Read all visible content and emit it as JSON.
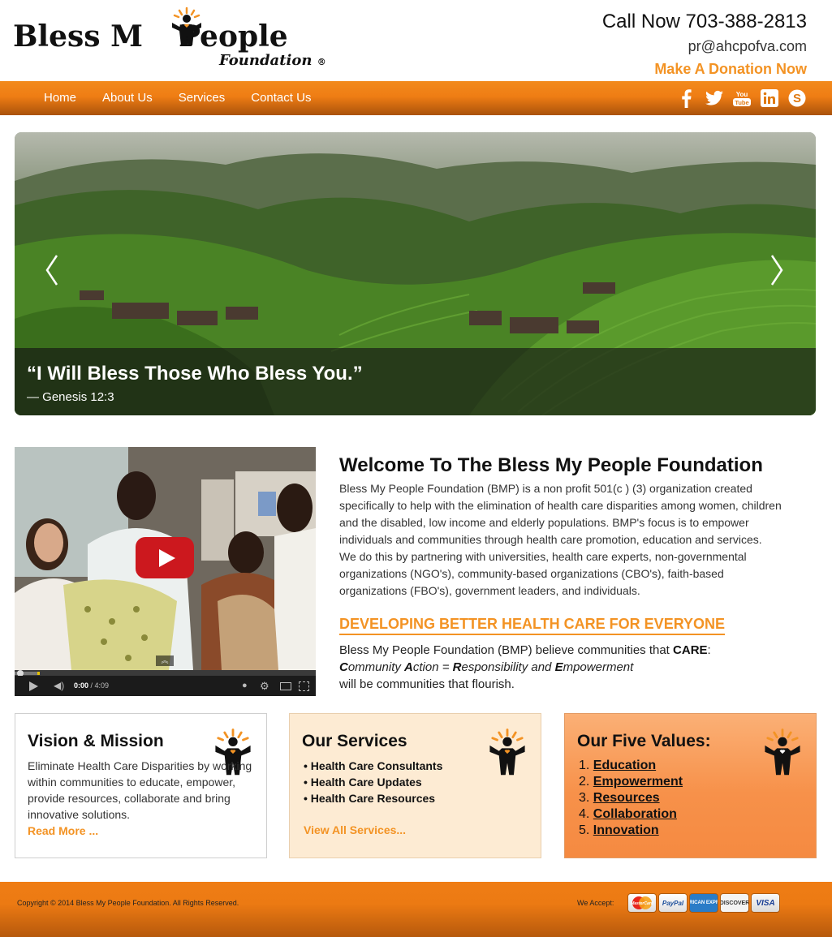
{
  "brand": {
    "name": "Bless My People",
    "name_left": "Bless M",
    "name_right": "People",
    "subtitle": "Foundation",
    "registered": "®"
  },
  "contact": {
    "call": "Call Now 703-388-2813",
    "email": "pr@ahcpofva.com",
    "donate": "Make A Donation Now"
  },
  "nav": {
    "items": [
      {
        "label": "Home"
      },
      {
        "label": "About Us"
      },
      {
        "label": "Services"
      },
      {
        "label": "Contact Us"
      }
    ]
  },
  "social": [
    {
      "icon": "facebook-icon",
      "glyph": "f"
    },
    {
      "icon": "twitter-icon",
      "glyph": "t"
    },
    {
      "icon": "youtube-icon",
      "glyph": "You Tube"
    },
    {
      "icon": "linkedin-icon",
      "glyph": "in"
    },
    {
      "icon": "skype-icon",
      "glyph": "S"
    }
  ],
  "hero": {
    "quote": "“I Will Bless Those Who Bless You.”",
    "cite": "— Genesis 12:3"
  },
  "video": {
    "current_time": "0:00",
    "duration": "/ 4:09",
    "progress": 0
  },
  "welcome": {
    "title": "Welcome To The Bless My People Foundation",
    "paragraph": "Bless My People Foundation (BMP) is a non profit 501(c ) (3) organization created specifically to help with the elimination of health care disparities among women, children and the disabled, low income and elderly populations. BMP's focus is to empower individuals and communities through health care promotion, education and services. We do this by partnering with universities, health care experts, non-governmental organizations (NGO's), community-based organizations (CBO's), faith-based organizations (FBO's), government leaders, and individuals.",
    "subheading": "DEVELOPING BETTER HEALTH CARE FOR EVERYONE",
    "care_line1_pre": "Bless My People Foundation (BMP) believe communities that ",
    "care_word": "CARE",
    "care_line1_post": ":",
    "care_acronym": [
      {
        "initial": "C",
        "rest": "ommunity "
      },
      {
        "initial": "A",
        "rest": "ction = "
      },
      {
        "initial": "R",
        "rest": "esponsibility and "
      },
      {
        "initial": "E",
        "rest": "mpowerment"
      }
    ],
    "care_line3": "will be communities that flourish."
  },
  "boxes": {
    "vision": {
      "title": "Vision & Mission",
      "text": "Eliminate Health Care Disparities by working within communities to educate, empower, provide resources, collaborate and bring innovative solutions.",
      "link": "Read More ..."
    },
    "services": {
      "title": "Our Services",
      "items": [
        "• Health Care Consultants",
        "• Health Care Updates",
        "• Health Care Resources"
      ],
      "link": "View All Services..."
    },
    "values": {
      "title": "Our Five Values:",
      "items": [
        {
          "num": "1. ",
          "label": "Education"
        },
        {
          "num": "2. ",
          "label": "Empowerment"
        },
        {
          "num": "3. ",
          "label": "Resources"
        },
        {
          "num": "4. ",
          "label": "Collaboration"
        },
        {
          "num": "5. ",
          "label": "Innovation"
        }
      ]
    }
  },
  "footer": {
    "copyright": "Copyright © 2014 Bless My People Foundation. All Rights Reserved.",
    "accept": "We Accept:",
    "cards": [
      "MasterCard",
      "PayPal",
      "AMERICAN EXPRESS",
      "DISCOVER",
      "VISA"
    ]
  },
  "colors": {
    "accent": "#f39324",
    "nav_top": "#f28a1c",
    "nav_bottom": "#a9520b",
    "services_bg": "#fdebd3",
    "values_bg": "#f7914a"
  }
}
